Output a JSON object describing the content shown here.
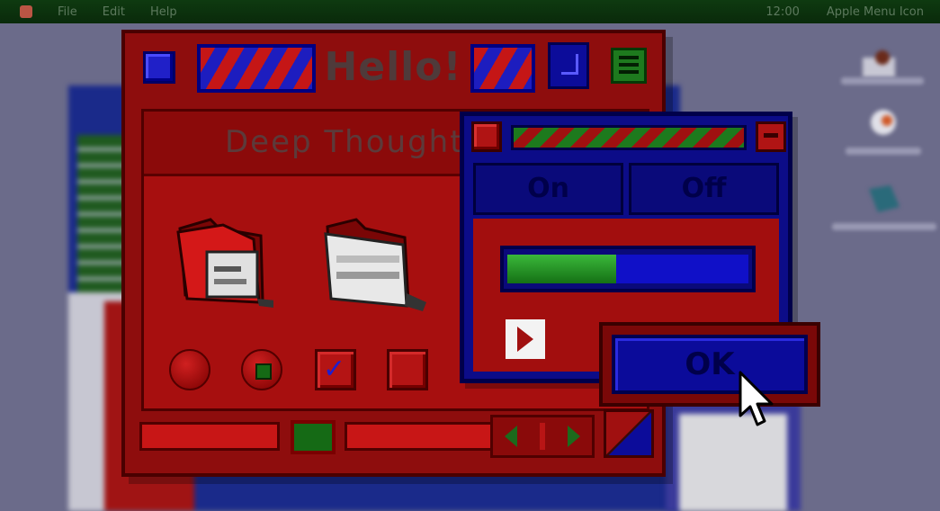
{
  "menubar": {
    "items": [
      "File",
      "Edit",
      "Help"
    ],
    "status": [
      "12:00",
      "Apple Menu Icon"
    ]
  },
  "main_window": {
    "title": "Hello!",
    "header_text": "Deep Thought"
  },
  "popup_window": {
    "toggle_on": "On",
    "toggle_off": "Off",
    "progress_fraction": 0.45
  },
  "ok_button": {
    "label": "OK"
  },
  "colors": {
    "window_red": "#a70f0f",
    "accent_blue": "#0c0c88",
    "accent_green": "#1d7a1d"
  }
}
